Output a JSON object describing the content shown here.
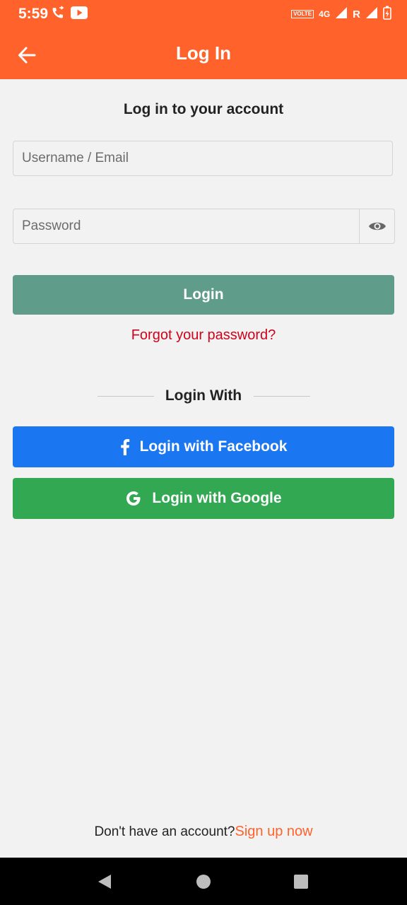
{
  "status_bar": {
    "time": "5:59",
    "volte": "VOLTE",
    "network_type": "4G",
    "roaming": "R",
    "icons": [
      "phone-forward-icon",
      "youtube-icon",
      "signal-icon",
      "battery-charging-icon"
    ]
  },
  "app_bar": {
    "title": "Log In",
    "back_icon": "arrow-left-icon"
  },
  "form": {
    "heading": "Log in to your account",
    "username_placeholder": "Username / Email",
    "username_value": "",
    "password_placeholder": "Password",
    "password_value": "",
    "password_toggle_icon": "eye-icon",
    "login_label": "Login",
    "forgot_label": "Forgot your password?"
  },
  "social": {
    "divider_label": "Login With",
    "facebook_label": "Login with Facebook",
    "google_label": "Login with Google"
  },
  "footer": {
    "prompt": "Don't have an account?",
    "signup_label": "Sign up now"
  },
  "nav_bar": {
    "icons": [
      "back-triangle-icon",
      "home-circle-icon",
      "recents-square-icon"
    ]
  },
  "colors": {
    "primary": "#ff632b",
    "login_button": "#5f9c8a",
    "facebook": "#1b76f1",
    "google": "#33a852",
    "error_link": "#d0021b"
  }
}
